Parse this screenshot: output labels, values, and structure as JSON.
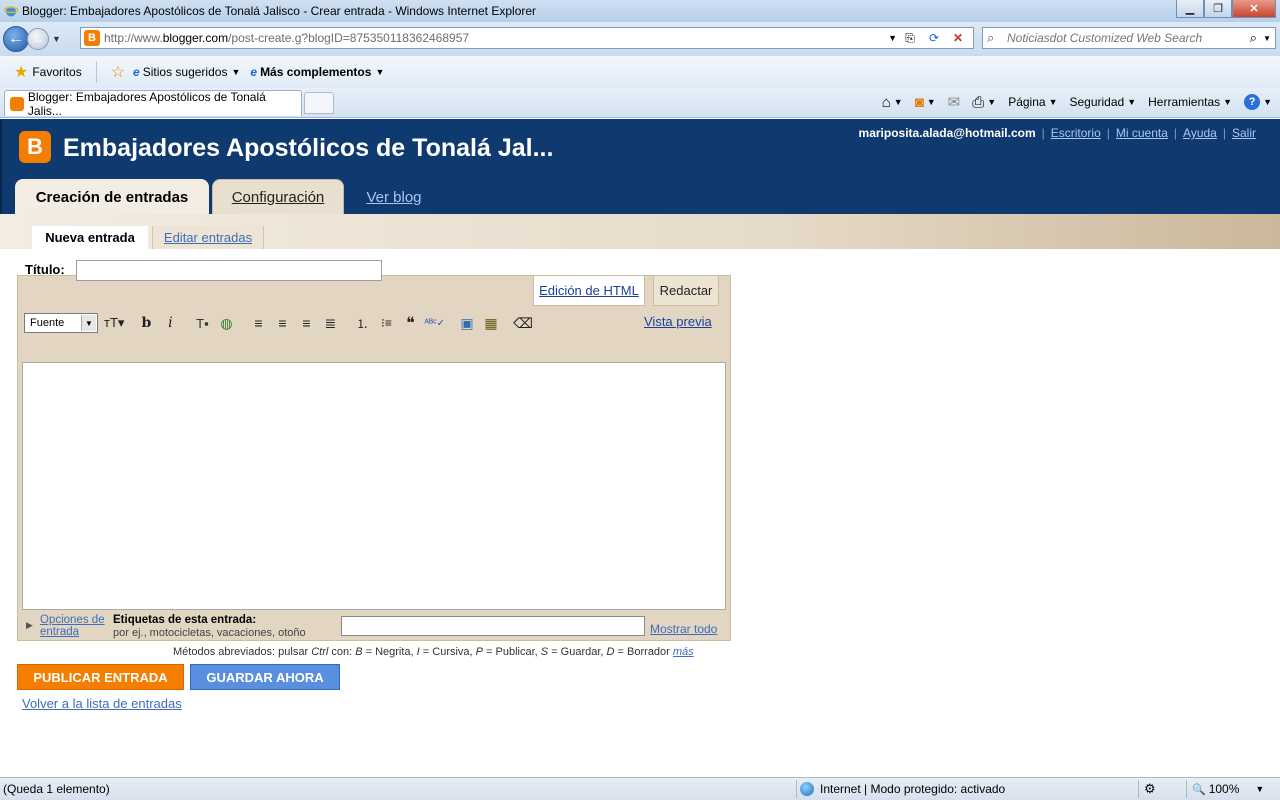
{
  "window": {
    "title": "Blogger: Embajadores Apostólicos de Tonalá Jalisco - Crear entrada - Windows Internet Explorer",
    "minimize_glyph": "▁",
    "maximize_glyph": "❐",
    "close_glyph": "✕"
  },
  "nav": {
    "back_glyph": "←",
    "forward_glyph": "→",
    "dropdown_glyph": "▼",
    "url_prefix": "http://www.",
    "url_domain": "blogger.com",
    "url_path": "/post-create.g?blogID=875350118362468957",
    "favicon_letter": "B",
    "compat_glyph": "⎘",
    "refresh_glyph": "⟳",
    "stop_glyph": "✕",
    "search_placeholder": "Noticiasdot Customized Web Search",
    "search_glyph": "⌕"
  },
  "favorites_bar": {
    "favoritos": "Favoritos",
    "sitios_sugeridos": "Sitios sugeridos",
    "mas_complementos": "Más complementos",
    "ie_letter": "e",
    "star_glyph": "★",
    "add_glyph": "☆"
  },
  "tabs": {
    "active_label": "Blogger: Embajadores Apostólicos de Tonalá Jalis..."
  },
  "command_bar": {
    "home_glyph": "⌂",
    "feeds_glyph": "◙",
    "mail_glyph": "✉",
    "print_glyph": "⎙",
    "pagina": "Página",
    "seguridad": "Seguridad",
    "herramientas": "Herramientas",
    "help_glyph": "?"
  },
  "blogger": {
    "logo_letter": "B",
    "blog_title": "Embajadores Apostólicos de Tonalá Jal...",
    "user_email": "mariposita.alada@hotmail.com",
    "links": {
      "escritorio": "Escritorio",
      "mi_cuenta": "Mi cuenta",
      "ayuda": "Ayuda",
      "salir": "Salir",
      "separator": "|"
    },
    "main_tabs": {
      "creacion": "Creación de entradas",
      "configuracion": "Configuración",
      "ver_blog": "Ver blog"
    },
    "sub_tabs": {
      "nueva": "Nueva entrada",
      "editar": "Editar entradas"
    },
    "titulo_label": "Título:",
    "mode_tabs": {
      "html": "Edición de HTML",
      "redactar": "Redactar"
    },
    "toolbar": {
      "font": "Fuente",
      "font_arrow": "▼",
      "font_size": "тT▾",
      "bold": "b",
      "italic": "i",
      "text_color": "T▪",
      "link": "◍",
      "align_left": "≡",
      "align_center": "≡",
      "align_right": "≡",
      "justify": "≣",
      "numbered_list": "⒈",
      "bullet_list": "⁝≡",
      "blockquote": "❝",
      "spellcheck": "ᴬᴮᶜ✓",
      "image": "▣",
      "video": "▦",
      "remove_format": "⌫"
    },
    "vista_previa": "Vista previa",
    "tags": {
      "triangle": "▶",
      "opciones": "Opciones de entrada",
      "title": "Etiquetas de esta entrada:",
      "hint": "por ej., motocicletas, vacaciones, otoño",
      "mostrar_todo": "Mostrar todo"
    },
    "shortcuts": {
      "t1": "Métodos abreviados: pulsar ",
      "ctrl": "Ctrl",
      "t2": " con: ",
      "b": "B",
      "t3": " = Negrita, ",
      "i": "I",
      "t4": " = Cursiva, ",
      "p": "P",
      "t5": " = Publicar, ",
      "s": "S",
      "t6": " = Guardar, ",
      "d": "D",
      "t7": " = Borrador ",
      "mas": "más"
    },
    "publicar": "PUBLICAR ENTRADA",
    "guardar": "GUARDAR AHORA",
    "volver": "Volver a la lista de entradas"
  },
  "status": {
    "left": "(Queda 1 elemento)",
    "zone": "Internet | Modo protegido: activado",
    "zoom": "100%",
    "zoom_glyph": "🔍",
    "lock_glyph": "⚙"
  },
  "colors": {
    "blogger_header": "#0f3a70",
    "blogger_orange": "#f57d00",
    "save_blue": "#5a8fe0",
    "link_blue": "#3d6dbb"
  }
}
